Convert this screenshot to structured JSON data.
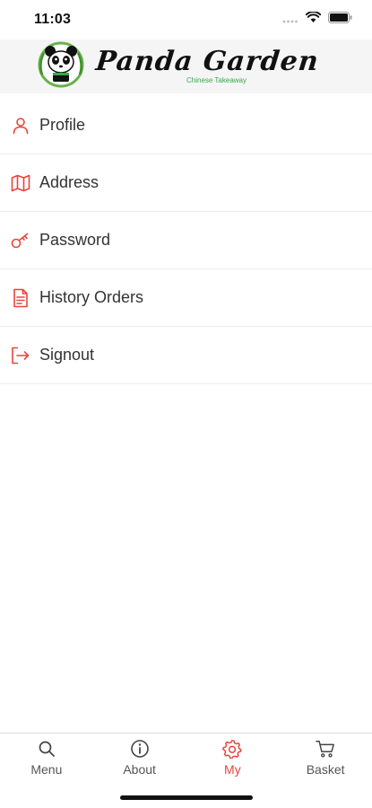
{
  "status_bar": {
    "time": "11:03"
  },
  "header": {
    "brand_name": "Panda Garden",
    "tagline": "Chinese Takeaway"
  },
  "menu": [
    {
      "label": "Profile",
      "icon": "user-icon"
    },
    {
      "label": "Address",
      "icon": "map-icon"
    },
    {
      "label": "Password",
      "icon": "key-icon"
    },
    {
      "label": "History Orders",
      "icon": "document-icon"
    },
    {
      "label": "Signout",
      "icon": "signout-icon"
    }
  ],
  "tabs": [
    {
      "label": "Menu",
      "icon": "search-icon",
      "active": false
    },
    {
      "label": "About",
      "icon": "info-icon",
      "active": false
    },
    {
      "label": "My",
      "icon": "gear-icon",
      "active": true
    },
    {
      "label": "Basket",
      "icon": "cart-icon",
      "active": false
    }
  ],
  "colors": {
    "accent": "#e8453c",
    "brand_green": "#3aa64a"
  }
}
